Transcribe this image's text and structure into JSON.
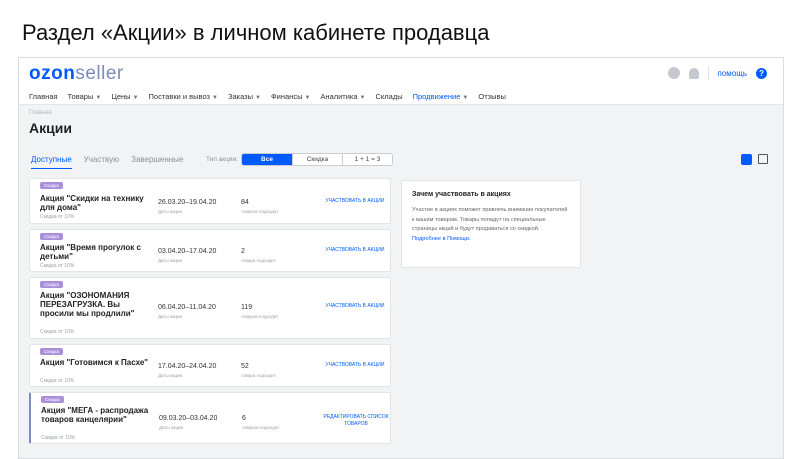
{
  "slide_title": "Раздел «Акции» в личном кабинете продавца",
  "header": {
    "logo_ozon": "ozon",
    "logo_seller": "seller",
    "help_label": "помощь",
    "help_icon": "?"
  },
  "nav": {
    "items": [
      {
        "label": "Главная",
        "dropdown": false
      },
      {
        "label": "Товары",
        "dropdown": true
      },
      {
        "label": "Цены",
        "dropdown": true
      },
      {
        "label": "Поставки и вывоз",
        "dropdown": true
      },
      {
        "label": "Заказы",
        "dropdown": true
      },
      {
        "label": "Финансы",
        "dropdown": true
      },
      {
        "label": "Аналитика",
        "dropdown": true
      },
      {
        "label": "Склады",
        "dropdown": false
      },
      {
        "label": "Продвижение",
        "dropdown": true,
        "active": true
      },
      {
        "label": "Отзывы",
        "dropdown": false
      }
    ]
  },
  "breadcrumb": "Главная",
  "page_title": "Акции",
  "tabs": [
    "Доступные",
    "Участвую",
    "Завершенные"
  ],
  "filter": {
    "label": "Тип акции:",
    "options": [
      "Все",
      "Скидка",
      "1 + 1 = 3"
    ],
    "selected": "Все"
  },
  "promos": [
    {
      "badge": "Скидка",
      "name": "Акция \"Скидки на технику для дома\"",
      "discount": "Скидка от 10%",
      "dates": "26.03.20–19.04.20",
      "dates_caption": "Даты акции",
      "count": "84",
      "count_caption": "товаров подходит",
      "action": "УЧАСТВОВАТЬ В АКЦИИ"
    },
    {
      "badge": "Скидка",
      "name": "Акция \"Время прогулок с детьми\"",
      "discount": "Скидка от 10%",
      "dates": "03.04.20–17.04.20",
      "dates_caption": "Даты акции",
      "count": "2",
      "count_caption": "товара подходит",
      "action": "УЧАСТВОВАТЬ В АКЦИИ"
    },
    {
      "badge": "Скидка",
      "name": "Акция \"ОЗОНОМАНИЯ ПЕРЕЗАГРУЗКА. Вы просили мы продлили\"",
      "discount": "Скидка от 10%",
      "dates": "06.04.20–11.04.20",
      "dates_caption": "Даты акции",
      "count": "119",
      "count_caption": "товаров подходит",
      "action": "УЧАСТВОВАТЬ В АКЦИИ"
    },
    {
      "badge": "Скидка",
      "name": "Акция \"Готовимся к Пасхе\"",
      "discount": "Скидка от 10%",
      "dates": "17.04.20–24.04.20",
      "dates_caption": "Даты акции",
      "count": "52",
      "count_caption": "товара подходит",
      "action": "УЧАСТВОВАТЬ В АКЦИИ"
    },
    {
      "badge": "Скидка",
      "name": "Акция \"МЕГА - распродажа товаров канцелярии\"",
      "discount": "Скидка от 10%",
      "dates": "09.03.20–03.04.20",
      "dates_caption": "Даты акции",
      "count": "6",
      "count_caption": "товаров подходит",
      "action": "РЕДАКТИРОВАТЬ СПИСОК ТОВАРОВ"
    }
  ],
  "info": {
    "title": "Зачем участвовать в акциях",
    "text": "Участие в акциях поможет привлечь внимание покупателей к вашим товарам. Товары попадут на специальные страницы акций и будут продаваться со скидкой.",
    "link": "Подробнее в Помощи."
  }
}
